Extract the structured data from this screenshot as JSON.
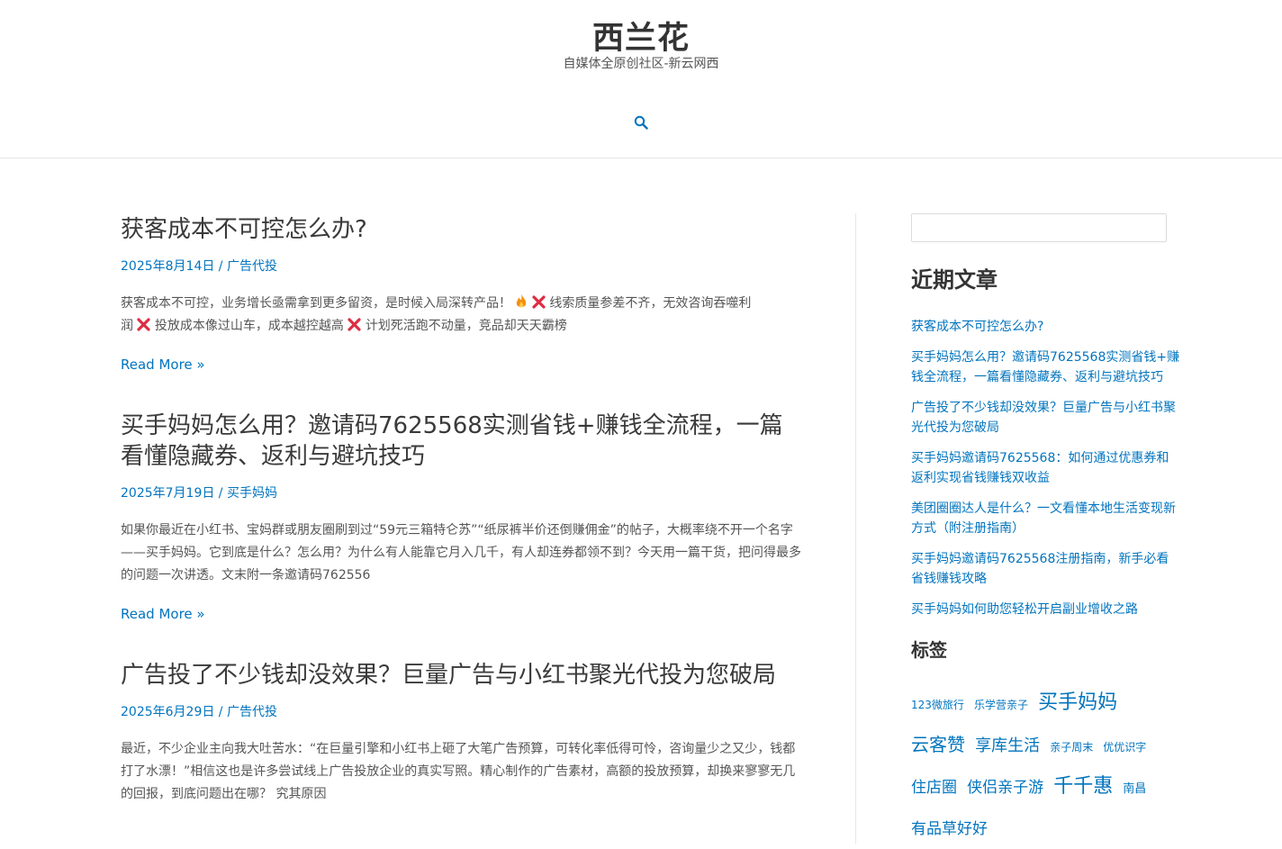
{
  "header": {
    "site_title": "西兰花",
    "site_description": "自媒体全原创社区-新云网西"
  },
  "colors": {
    "link": "#0274be",
    "text": "#3a3a3a",
    "border": "#e6e6e6"
  },
  "posts": [
    {
      "title": "获客成本不可控怎么办?",
      "date": "2025年8月14日",
      "sep": " / ",
      "category": "广告代投",
      "excerpt_line1": "获客成本不可控，业务增长亟需拿到更多留资，是时候入局深转产品！",
      "excerpt_line1b": "线索质量参差不齐，无效咨询吞噬利",
      "excerpt_line2a": "润",
      "excerpt_line2b": "投放成本像过山车，成本越控越高",
      "excerpt_line2c": "计划死活跑不动量，竞品却天天霸榜",
      "read_more": "Read More »"
    },
    {
      "title": "买手妈妈怎么用？邀请码7625568实测省钱+赚钱全流程，一篇看懂隐藏券、返利与避坑技巧",
      "date": "2025年7月19日",
      "sep": " / ",
      "category": "买手妈妈",
      "excerpt": "如果你最近在小红书、宝妈群或朋友圈刷到过“59元三箱特仑苏”“纸尿裤半价还倒赚佣金”的帖子，大概率绕不开一个名字——买手妈妈。它到底是什么？怎么用？为什么有人能靠它月入几千，有人却连券都领不到？今天用一篇干货，把问得最多的问题一次讲透。文末附一条邀请码762556",
      "read_more": "Read More »"
    },
    {
      "title": "广告投了不少钱却没效果？巨量广告与小红书聚光代投为您破局",
      "date": "2025年6月29日",
      "sep": " / ",
      "category": "广告代投",
      "excerpt": "最近，不少企业主向我大吐苦水：“在巨量引擎和小红书上砸了大笔广告预算，可转化率低得可怜，咨询量少之又少，钱都打了水漂！”相信这也是许多尝试线上广告投放企业的真实写照。精心制作的广告素材，高额的投放预算，却换来寥寥无几的回报，到底问题出在哪？ 究其原因"
    }
  ],
  "sidebar": {
    "search_placeholder": "",
    "recent_title": "近期文章",
    "recent_posts": [
      "获客成本不可控怎么办?",
      "买手妈妈怎么用？邀请码7625568实测省钱+赚钱全流程，一篇看懂隐藏券、返利与避坑技巧",
      "广告投了不少钱却没效果？巨量广告与小红书聚光代投为您破局",
      "买手妈妈邀请码7625568：如何通过优惠券和返利实现省钱赚钱双收益",
      "美团圈圈达人是什么？一文看懂本地生活变现新方式（附注册指南）",
      "买手妈妈邀请码7625568注册指南，新手必看省钱赚钱攻略",
      "买手妈妈如何助您轻松开启副业增收之路"
    ],
    "tags_title": "标签",
    "tags": [
      {
        "label": "123微旅行",
        "size": 12
      },
      {
        "label": "乐学营亲子",
        "size": 12
      },
      {
        "label": "买手妈妈",
        "size": 22
      },
      {
        "label": "云客赞",
        "size": 20
      },
      {
        "label": "享库生活",
        "size": 18
      },
      {
        "label": "亲子周末",
        "size": 12
      },
      {
        "label": "优优识字",
        "size": 12
      },
      {
        "label": "住店圈",
        "size": 17
      },
      {
        "label": "侠侣亲子游",
        "size": 17
      },
      {
        "label": "千千惠",
        "size": 22
      },
      {
        "label": "南昌",
        "size": 13
      },
      {
        "label": "有品草好好",
        "size": 17
      }
    ]
  }
}
